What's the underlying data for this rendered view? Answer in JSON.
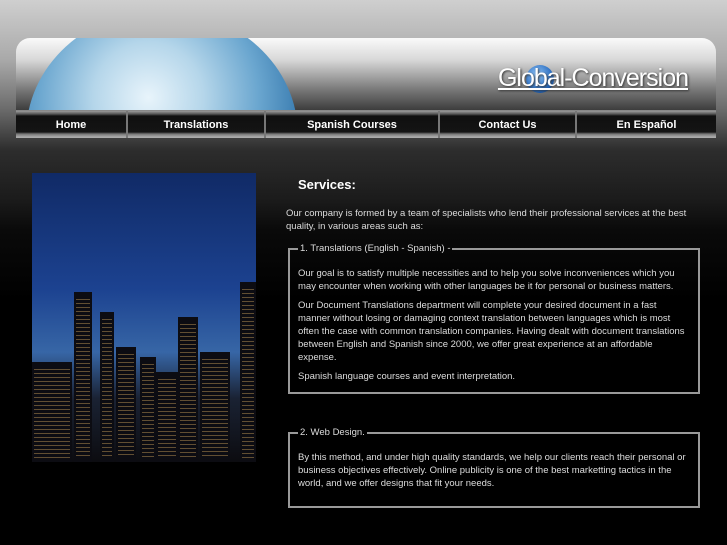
{
  "brand": {
    "logo_text": "Global-Conversion"
  },
  "nav": [
    {
      "label": "Home"
    },
    {
      "label": "Translations"
    },
    {
      "label": "Spanish Courses"
    },
    {
      "label": "Contact Us"
    },
    {
      "label": "En Español"
    }
  ],
  "main": {
    "title": "Services:",
    "intro": "Our company is formed by a team of specialists who lend their professional services at the best quality, in various areas such as:",
    "sections": [
      {
        "legend": "1. Translations (English - Spanish) -",
        "paragraphs": [
          "Our goal is to satisfy multiple necessities and to help you solve inconveniences which you may encounter when working with other languages be it for personal or business matters.",
          "Our Document Translations department will complete your desired document in a fast manner without losing or damaging context translation between languages which is most often the case with common translation companies. Having dealt with document translations between English and Spanish since 2000, we offer great experience at an affordable expense.",
          "Spanish language courses and event interpretation."
        ]
      },
      {
        "legend": "2. Web Design.",
        "paragraphs": [
          "By this method, and under high quality standards, we help our clients reach their personal or business objectives effectively. Online publicity is one of the best marketting tactics in the world, and we offer designs that fit your needs."
        ]
      }
    ]
  }
}
